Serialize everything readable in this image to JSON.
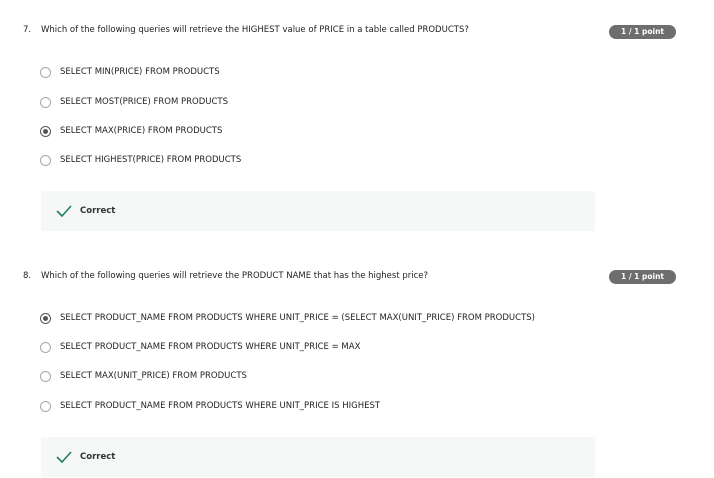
{
  "questions": [
    {
      "number": "7.",
      "text": "Which of the following queries will retrieve the HIGHEST value of PRICE in a table called PRODUCTS?",
      "score": "1 / 1 point",
      "options": [
        "SELECT MIN(PRICE) FROM PRODUCTS",
        "SELECT MOST(PRICE) FROM PRODUCTS",
        "SELECT MAX(PRICE) FROM PRODUCTS",
        "SELECT HIGHEST(PRICE) FROM PRODUCTS"
      ],
      "selected_index": 2,
      "feedback": "Correct"
    },
    {
      "number": "8.",
      "text": "Which of the following queries will retrieve the PRODUCT NAME that has the highest price?",
      "score": "1 / 1 point",
      "options": [
        "SELECT PRODUCT_NAME FROM PRODUCTS WHERE UNIT_PRICE = (SELECT MAX(UNIT_PRICE) FROM PRODUCTS)",
        "SELECT PRODUCT_NAME FROM PRODUCTS WHERE UNIT_PRICE = MAX",
        "SELECT MAX(UNIT_PRICE) FROM PRODUCTS",
        "SELECT PRODUCT_NAME FROM PRODUCTS WHERE UNIT_PRICE IS HIGHEST"
      ],
      "selected_index": 0,
      "feedback": "Correct"
    }
  ],
  "colors": {
    "check": "#1f8354",
    "badge": "#6e6e6e",
    "feedback_bg": "#f5f8f7"
  }
}
